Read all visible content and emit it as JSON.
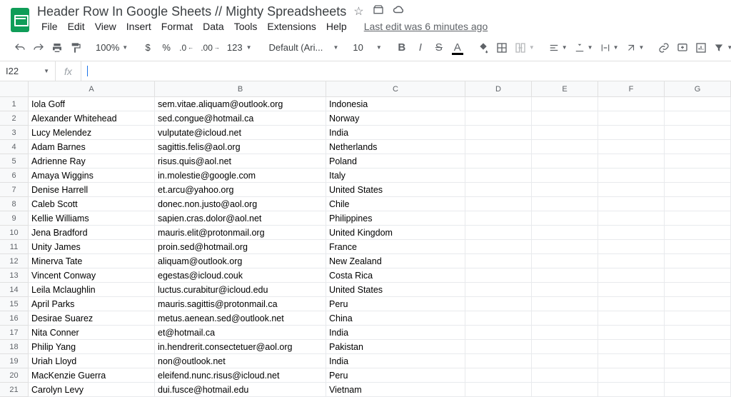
{
  "doc": {
    "title": "Header Row In Google Sheets // Mighty Spreadsheets"
  },
  "menu": {
    "file": "File",
    "edit": "Edit",
    "view": "View",
    "insert": "Insert",
    "format": "Format",
    "data": "Data",
    "tools": "Tools",
    "extensions": "Extensions",
    "help": "Help",
    "last_edit": "Last edit was 6 minutes ago"
  },
  "toolbar": {
    "zoom": "100%",
    "currency": "$",
    "percent": "%",
    "dec_minus": ".0",
    "dec_plus": ".00",
    "fmt": "123",
    "font": "Default (Ari...",
    "size": "10",
    "bold": "B",
    "italic": "I",
    "strike": "S",
    "text_color": "A"
  },
  "namebox": {
    "ref": "I22",
    "fx": "fx"
  },
  "columns": [
    "A",
    "B",
    "C",
    "D",
    "E",
    "F",
    "G"
  ],
  "rows": [
    {
      "n": "1",
      "a": "Iola Goff",
      "b": "sem.vitae.aliquam@outlook.org",
      "c": "Indonesia"
    },
    {
      "n": "2",
      "a": "Alexander Whitehead",
      "b": "sed.congue@hotmail.ca",
      "c": "Norway"
    },
    {
      "n": "3",
      "a": "Lucy Melendez",
      "b": "vulputate@icloud.net",
      "c": "India"
    },
    {
      "n": "4",
      "a": "Adam Barnes",
      "b": "sagittis.felis@aol.org",
      "c": "Netherlands"
    },
    {
      "n": "5",
      "a": "Adrienne Ray",
      "b": "risus.quis@aol.net",
      "c": "Poland"
    },
    {
      "n": "6",
      "a": "Amaya Wiggins",
      "b": "in.molestie@google.com",
      "c": "Italy"
    },
    {
      "n": "7",
      "a": "Denise Harrell",
      "b": "et.arcu@yahoo.org",
      "c": "United States"
    },
    {
      "n": "8",
      "a": "Caleb Scott",
      "b": "donec.non.justo@aol.org",
      "c": "Chile"
    },
    {
      "n": "9",
      "a": "Kellie Williams",
      "b": "sapien.cras.dolor@aol.net",
      "c": "Philippines"
    },
    {
      "n": "10",
      "a": "Jena Bradford",
      "b": "mauris.elit@protonmail.org",
      "c": "United Kingdom"
    },
    {
      "n": "11",
      "a": "Unity James",
      "b": "proin.sed@hotmail.org",
      "c": "France"
    },
    {
      "n": "12",
      "a": "Minerva Tate",
      "b": "aliquam@outlook.org",
      "c": "New Zealand"
    },
    {
      "n": "13",
      "a": "Vincent Conway",
      "b": "egestas@icloud.couk",
      "c": "Costa Rica"
    },
    {
      "n": "14",
      "a": "Leila Mclaughlin",
      "b": "luctus.curabitur@icloud.edu",
      "c": "United States"
    },
    {
      "n": "15",
      "a": "April Parks",
      "b": "mauris.sagittis@protonmail.ca",
      "c": "Peru"
    },
    {
      "n": "16",
      "a": "Desirae Suarez",
      "b": "metus.aenean.sed@outlook.net",
      "c": "China"
    },
    {
      "n": "17",
      "a": "Nita Conner",
      "b": "et@hotmail.ca",
      "c": "India"
    },
    {
      "n": "18",
      "a": "Philip Yang",
      "b": "in.hendrerit.consectetuer@aol.org",
      "c": "Pakistan"
    },
    {
      "n": "19",
      "a": "Uriah Lloyd",
      "b": "non@outlook.net",
      "c": "India"
    },
    {
      "n": "20",
      "a": "MacKenzie Guerra",
      "b": "eleifend.nunc.risus@icloud.net",
      "c": "Peru"
    },
    {
      "n": "21",
      "a": "Carolyn Levy",
      "b": "dui.fusce@hotmail.edu",
      "c": "Vietnam"
    }
  ]
}
